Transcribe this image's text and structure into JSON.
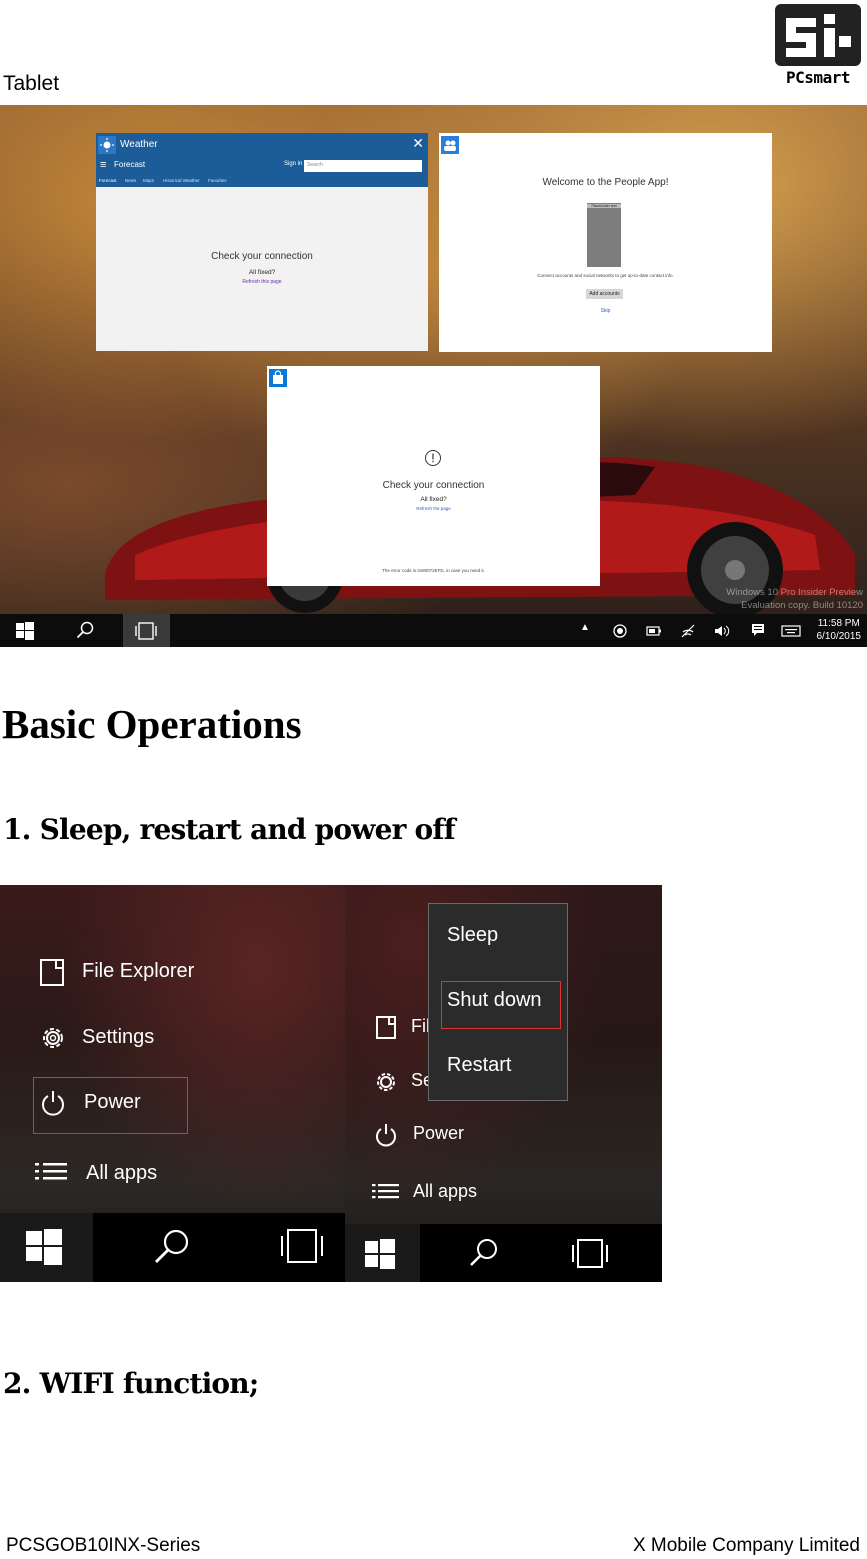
{
  "header": {
    "title": "Tablet",
    "logo_text": "PCsmart"
  },
  "screenshot1": {
    "windows": [
      {
        "title": "Weather",
        "app_bar_title": "Forecast",
        "sign_in": "Sign in",
        "search_placeholder": "Search",
        "tabs": [
          "Forecast",
          "News",
          "Maps",
          "Historical Weather",
          "Favorites"
        ],
        "message": "Check your connection",
        "sub": "All fixed?",
        "link": "Refresh this page"
      },
      {
        "title": "People",
        "heading": "Welcome to the People App!",
        "placeholder_label": "Placeholder text",
        "description": "Connect accounts and social networks to get up-to-date contact info.",
        "button": "Add accounts",
        "link": "Skip"
      },
      {
        "title": "Store (Beta)",
        "message": "Check your connection",
        "sub": "All fixed?",
        "link": "Refresh the page",
        "footer": "The error code is 0x80072EFD, in case you need it."
      }
    ],
    "watermark_line1": "Windows 10 Pro Insider Preview",
    "watermark_line2": "Evaluation copy. Build 10120",
    "time": "11:58 PM",
    "date": "6/10/2015"
  },
  "headings": {
    "basic": "Basic Operations",
    "step1": "1. Sleep, restart and power off",
    "step2": "2. WIFI function;"
  },
  "screenshot2": {
    "items": [
      "File Explorer",
      "Settings",
      "Power",
      "All apps"
    ]
  },
  "screenshot3": {
    "popup": [
      "Sleep",
      "Shut down",
      "Restart"
    ],
    "partial_items": [
      "Fil",
      "Se"
    ],
    "items": [
      "Power",
      "All apps"
    ]
  },
  "footer": {
    "left": "PCSGOB10INX-Series",
    "right": "X Mobile Company Limited"
  },
  "colors": {
    "highlight_red": "#e03232",
    "win_blue": "#1c5d99",
    "store_blue": "#0a78d7",
    "people_blue": "#2b7ddc"
  }
}
